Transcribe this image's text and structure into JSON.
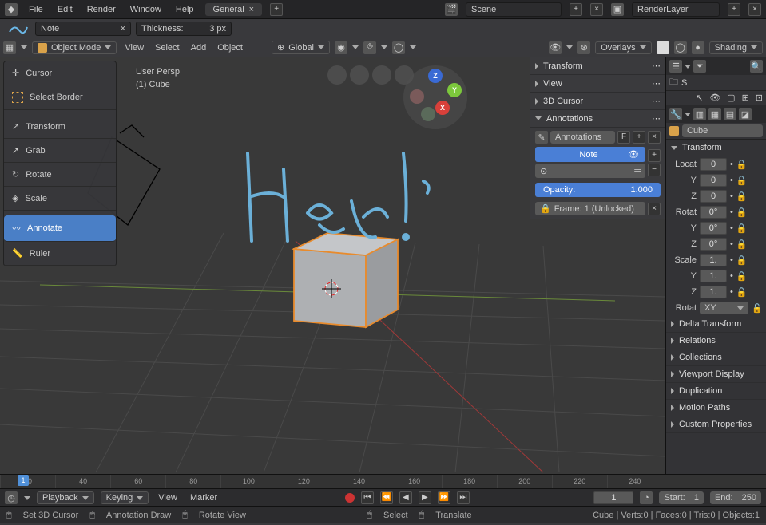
{
  "menu": {
    "file": "File",
    "edit": "Edit",
    "render": "Render",
    "window": "Window",
    "help": "Help"
  },
  "workspace_tab": "General",
  "scene_field": "Scene",
  "layer_field": "RenderLayer",
  "annot_layer": "Note",
  "thickness_label": "Thickness:",
  "thickness_value": "3 px",
  "mode": "Object Mode",
  "hdr_menu": {
    "view": "View",
    "select": "Select",
    "add": "Add",
    "object": "Object"
  },
  "orientation": "Global",
  "overlays": "Overlays",
  "shading": "Shading",
  "viewport_info": {
    "persp": "User Persp",
    "obj": "(1) Cube"
  },
  "tools": {
    "cursor": "Cursor",
    "select_border": "Select Border",
    "transform": "Transform",
    "grab": "Grab",
    "rotate": "Rotate",
    "scale": "Scale",
    "annotate": "Annotate",
    "ruler": "Ruler"
  },
  "npanel": {
    "transform": "Transform",
    "view": "View",
    "cursor": "3D Cursor",
    "annotations": "Annotations",
    "annot_field": "Annotations",
    "f_btn": "F",
    "note": "Note",
    "opacity_label": "Opacity:",
    "opacity_value": "1.000",
    "frame_label": "Frame: 1 (Unlocked)"
  },
  "props": {
    "object_name": "Cube",
    "transform_hdr": "Transform",
    "locat": "Locat",
    "rotat": "Rotat",
    "scale": "Scale",
    "y": "Y",
    "z": "Z",
    "loc_vals": [
      "0",
      "0",
      "0"
    ],
    "rot_vals": [
      "0°",
      "0°",
      "0°"
    ],
    "scale_vals": [
      "1.",
      "1.",
      "1."
    ],
    "rot_mode_label": "Rotat",
    "rot_mode": "XY",
    "sections": [
      "Delta Transform",
      "Relations",
      "Collections",
      "Viewport Display",
      "Duplication",
      "Motion Paths",
      "Custom Properties"
    ]
  },
  "outliner_s": "S",
  "timeline": {
    "ticks": [
      "20",
      "40",
      "60",
      "80",
      "100",
      "120",
      "140",
      "160",
      "180",
      "200",
      "220",
      "240"
    ],
    "cursor": "1",
    "playback": "Playback",
    "keying": "Keying",
    "view": "View",
    "marker": "Marker",
    "current": "1",
    "start_label": "Start:",
    "start": "1",
    "end_label": "End:",
    "end": "250"
  },
  "status": {
    "set_cursor": "Set 3D Cursor",
    "annot_draw": "Annotation Draw",
    "rotate_view": "Rotate View",
    "select": "Select",
    "translate": "Translate",
    "stats": "Cube | Verts:0 | Faces:0 | Tris:0 | Objects:1"
  }
}
